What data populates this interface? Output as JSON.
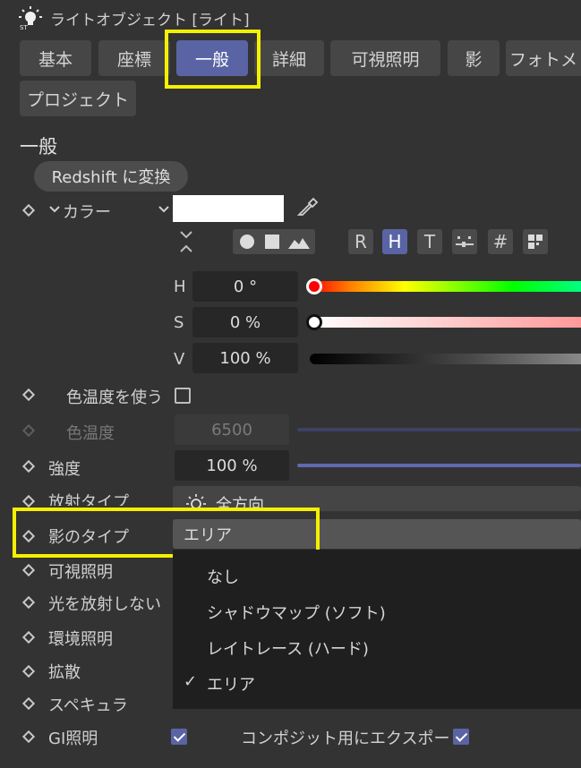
{
  "window": {
    "title": "ライトオブジェクト [ライト]",
    "icon": "light-bulb-icon"
  },
  "tabs": [
    {
      "label": "基本",
      "active": false
    },
    {
      "label": "座標",
      "active": false
    },
    {
      "label": "一般",
      "active": true
    },
    {
      "label": "詳細",
      "active": false
    },
    {
      "label": "可視照明",
      "active": false
    },
    {
      "label": "影",
      "active": false
    },
    {
      "label": "フォトメト",
      "active": false
    },
    {
      "label": "プロジェクト",
      "active": false
    }
  ],
  "section": {
    "title": "一般",
    "convert_label": "Redshift に変換"
  },
  "color": {
    "label": "カラー",
    "swatch": "#ffffff",
    "modes": [
      "R",
      "H",
      "T"
    ],
    "active_mode": "H",
    "h": {
      "label": "H",
      "value": "0 °"
    },
    "s": {
      "label": "S",
      "value": "0 %"
    },
    "v": {
      "label": "V",
      "value": "100 %"
    }
  },
  "properties": {
    "use_color_temp": {
      "label": "色温度を使う",
      "checked": false
    },
    "color_temp": {
      "label": "色温度",
      "value": "6500"
    },
    "intensity": {
      "label": "強度",
      "value": "100 %"
    },
    "radiation_type": {
      "label": "放射タイプ",
      "value": "全方向"
    },
    "shadow_type": {
      "label": "影のタイプ",
      "value": "エリア"
    },
    "visible_light": {
      "label": "可視照明"
    },
    "no_light_radiation": {
      "label": "光を放射しない"
    },
    "ambient_light": {
      "label": "環境照明"
    },
    "diffuse": {
      "label": "拡散"
    },
    "specular": {
      "label": "スペキュラ"
    },
    "gi_light": {
      "label": "GI照明",
      "checked": true
    },
    "composite_export": {
      "label": "コンポジット用にエクスポート",
      "checked": true
    }
  },
  "shadow_menu": {
    "options": [
      "なし",
      "シャドウマップ (ソフト)",
      "レイトレース (ハード)",
      "エリア"
    ],
    "selected": "エリア",
    "check": "✓"
  },
  "colors": {
    "accent": "#5a64a4",
    "highlight": "#f4f000",
    "panel": "#333333"
  }
}
